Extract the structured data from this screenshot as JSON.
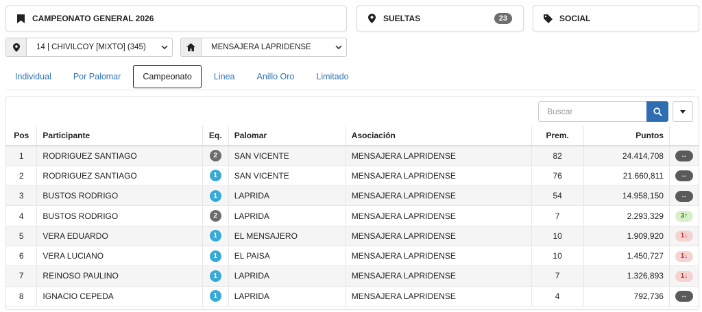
{
  "header": {
    "campeonato": "CAMPEONATO GENERAL 2026",
    "sueltas_label": "SUELTAS",
    "sueltas_count": "23",
    "social_label": "SOCIAL"
  },
  "filters": {
    "location_value": "14 | CHIVILCOY [MIXTO] (345)",
    "club_value": "MENSAJERA LAPRIDENSE"
  },
  "tabs": [
    "Individual",
    "Por Palomar",
    "Campeonato",
    "Linea",
    "Anillo Oro",
    "Limitado"
  ],
  "active_tab": "Campeonato",
  "search": {
    "placeholder": "Buscar"
  },
  "table": {
    "headers": [
      "Pos",
      "Participante",
      "Eq.",
      "Palomar",
      "Asociación",
      "Prem.",
      "Puntos"
    ],
    "rows": [
      {
        "pos": "1",
        "participante": "RODRIGUEZ SANTIAGO",
        "eq": "2",
        "palomar": "SAN VICENTE",
        "asociacion": "MENSAJERA LAPRIDENSE",
        "prem": "82",
        "puntos": "24.414,708",
        "trend": "same",
        "trend_text": "↔"
      },
      {
        "pos": "2",
        "participante": "RODRIGUEZ SANTIAGO",
        "eq": "1",
        "palomar": "SAN VICENTE",
        "asociacion": "MENSAJERA LAPRIDENSE",
        "prem": "76",
        "puntos": "21.660,811",
        "trend": "same",
        "trend_text": "↔"
      },
      {
        "pos": "3",
        "participante": "BUSTOS RODRIGO",
        "eq": "1",
        "palomar": "LAPRIDA",
        "asociacion": "MENSAJERA LAPRIDENSE",
        "prem": "54",
        "puntos": "14.958,150",
        "trend": "same",
        "trend_text": "↔"
      },
      {
        "pos": "4",
        "participante": "BUSTOS RODRIGO",
        "eq": "2",
        "palomar": "LAPRIDA",
        "asociacion": "MENSAJERA LAPRIDENSE",
        "prem": "7",
        "puntos": "2.293,329",
        "trend": "up",
        "trend_text": "3↑"
      },
      {
        "pos": "5",
        "participante": "VERA EDUARDO",
        "eq": "1",
        "palomar": "EL MENSAJERO",
        "asociacion": "MENSAJERA LAPRIDENSE",
        "prem": "10",
        "puntos": "1.909,920",
        "trend": "down",
        "trend_text": "1↓"
      },
      {
        "pos": "6",
        "participante": "VERA LUCIANO",
        "eq": "1",
        "palomar": "EL PAISA",
        "asociacion": "MENSAJERA LAPRIDENSE",
        "prem": "10",
        "puntos": "1.450,727",
        "trend": "down",
        "trend_text": "1↓"
      },
      {
        "pos": "7",
        "participante": "REINOSO PAULINO",
        "eq": "1",
        "palomar": "LAPRIDA",
        "asociacion": "MENSAJERA LAPRIDENSE",
        "prem": "7",
        "puntos": "1.326,893",
        "trend": "down",
        "trend_text": "1↓"
      },
      {
        "pos": "8",
        "participante": "IGNACIO CEPEDA",
        "eq": "1",
        "palomar": "LAPRIDA",
        "asociacion": "MENSAJERA LAPRIDENSE",
        "prem": "4",
        "puntos": "792,736",
        "trend": "same",
        "trend_text": "↔"
      }
    ]
  },
  "colors": {
    "link": "#2f74b5",
    "search_button": "#2f6db3",
    "eq_1": "#3aa9d6",
    "eq_2": "#6d6d6d"
  }
}
